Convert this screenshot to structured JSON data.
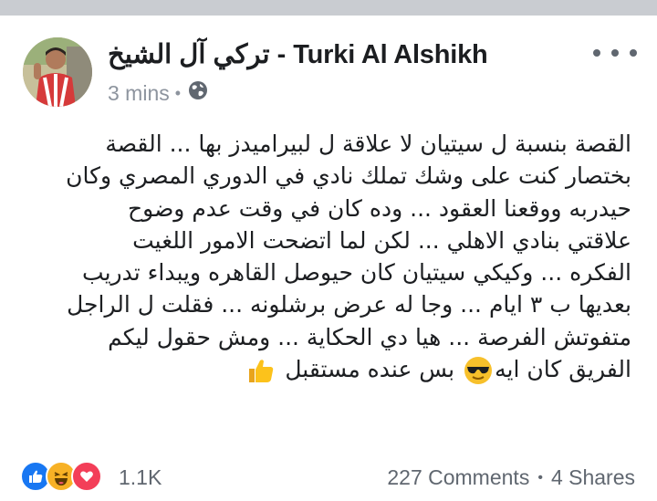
{
  "post": {
    "author": "تركي آل الشيخ - Turki Al Alshikh",
    "time": "3 mins",
    "privacy_icon": "globe-icon",
    "menu_icon": "more-options-icon",
    "body_lines": [
      "القصة بنسبة ل سيتيان لا علاقة ل لبيراميدز بها ... القصة",
      "بختصار كنت على وشك تملك نادي في الدوري المصري وكان",
      "حيدربه ووقعنا العقود ... وده كان في وقت عدم وضوح",
      "علاقتي بنادي الاهلي ... لكن لما اتضحت الامور اللغيت",
      "الفكره ... وكيكي سيتيان كان حيوصل القاهره ويبداء تدريب",
      "بعديها ب ٣ ايام ... وجا له عرض برشلونه ... فقلت ل الراجل",
      "متفوتش الفرصة ... هيا دي الحكاية ... ومش حقول ليكم"
    ],
    "last_line_start": "الفريق كان ايه",
    "last_line_end": "بس عنده مستقبل",
    "emoji_sunglasses": "sunglasses-emoji",
    "emoji_thumbs": "thumbs-up-emoji"
  },
  "footer": {
    "reaction_icons": [
      "like-icon",
      "haha-icon",
      "love-icon"
    ],
    "reaction_count": "1.1K",
    "comments": "227 Comments",
    "shares": "4 Shares",
    "colors": {
      "like": "#1877f2",
      "haha": "#f7b125",
      "love": "#f33e58"
    }
  }
}
